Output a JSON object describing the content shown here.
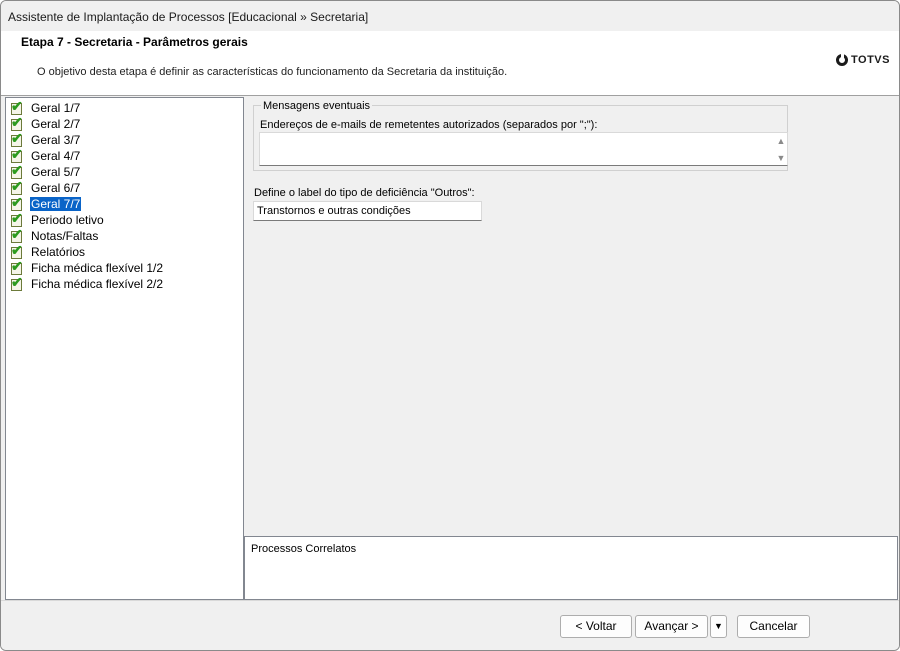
{
  "window": {
    "title": "Assistente de Implantação de Processos [Educacional » Secretaria]"
  },
  "header": {
    "step_title": "Etapa 7 - Secretaria - Parâmetros gerais",
    "description": "O objetivo desta etapa é definir as características do funcionamento da Secretaria da instituição.",
    "logo_text": "TOTVS"
  },
  "tree": {
    "items": [
      {
        "label": "Geral 1/7",
        "checked": true,
        "selected": false
      },
      {
        "label": "Geral 2/7",
        "checked": true,
        "selected": false
      },
      {
        "label": "Geral 3/7",
        "checked": true,
        "selected": false
      },
      {
        "label": "Geral 4/7",
        "checked": true,
        "selected": false
      },
      {
        "label": "Geral 5/7",
        "checked": true,
        "selected": false
      },
      {
        "label": "Geral 6/7",
        "checked": true,
        "selected": false
      },
      {
        "label": "Geral 7/7",
        "checked": true,
        "selected": true
      },
      {
        "label": "Periodo letivo",
        "checked": true,
        "selected": false
      },
      {
        "label": "Notas/Faltas",
        "checked": true,
        "selected": false
      },
      {
        "label": "Relatórios",
        "checked": true,
        "selected": false
      },
      {
        "label": "Ficha médica flexível 1/2",
        "checked": true,
        "selected": false
      },
      {
        "label": "Ficha médica flexível 2/2",
        "checked": true,
        "selected": false
      }
    ]
  },
  "content": {
    "group_legend": "Mensagens eventuais",
    "emails_label": "Endereços de e-mails de remetentes autorizados (separados por \";\"):",
    "emails_value": "",
    "deficiency_label": "Define o label do tipo de deficiência \"Outros\":",
    "deficiency_value": "Transtornos e outras condições"
  },
  "related": {
    "label": "Processos Correlatos"
  },
  "footer": {
    "back_label": "< Voltar",
    "next_label": "Avançar >",
    "dropdown_label": "▼",
    "cancel_label": "Cancelar"
  },
  "colors": {
    "selection": "#0a64c8",
    "check": "#2c9a1e",
    "window_bg": "#f0f0f0"
  }
}
